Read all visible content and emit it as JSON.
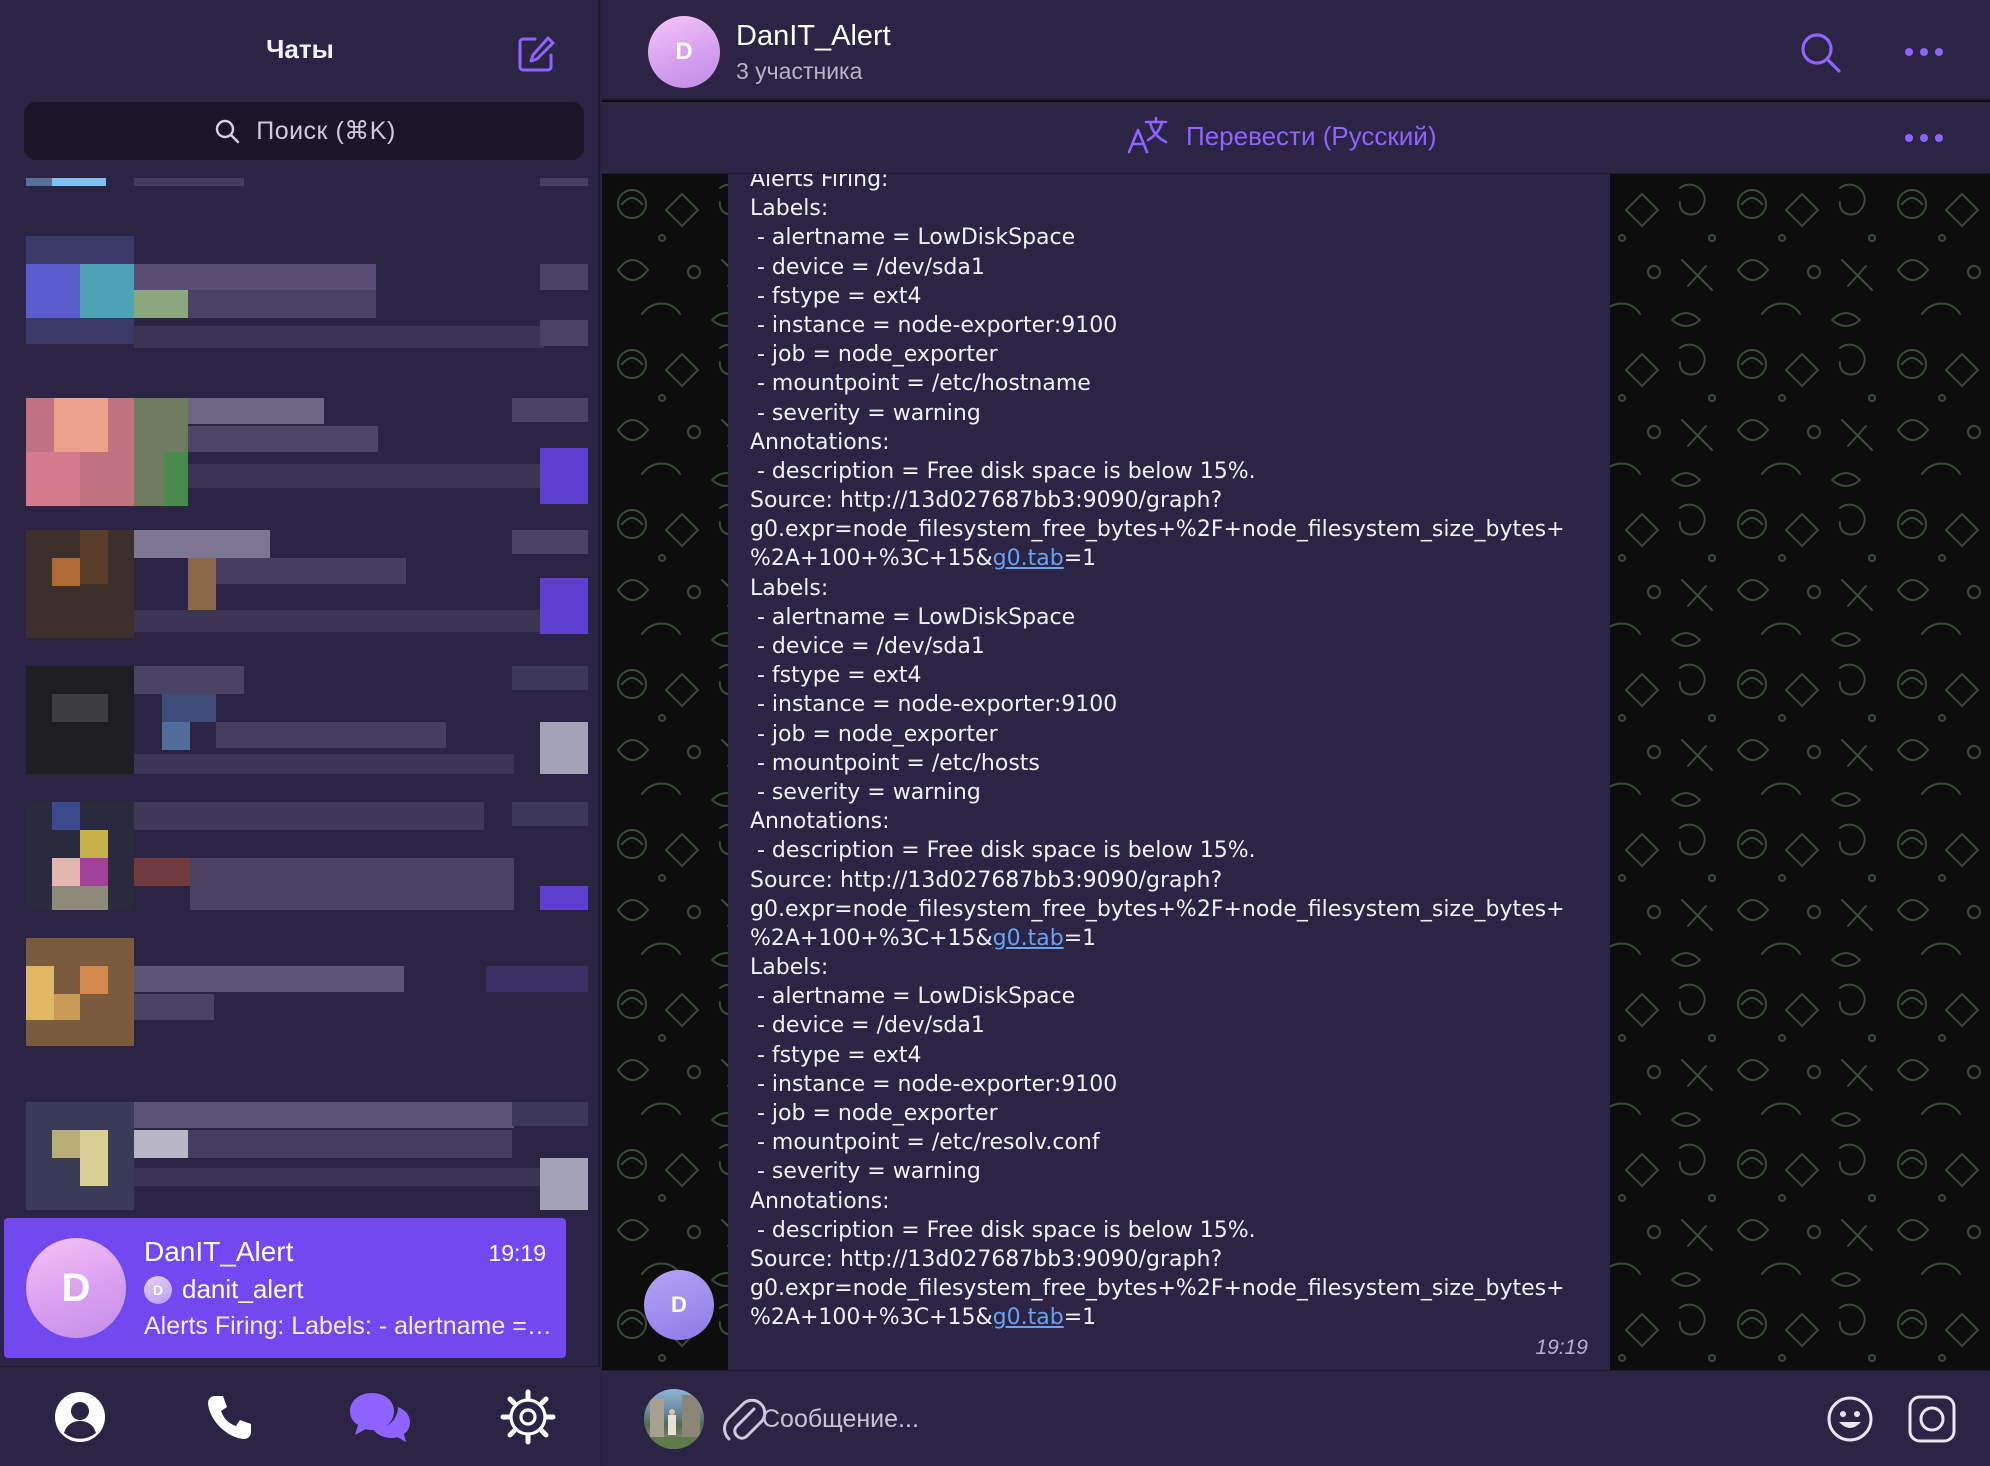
{
  "sidebar": {
    "title": "Чаты",
    "search_placeholder": "Поиск (⌘K)",
    "active_chat": {
      "avatar_letter": "D",
      "name": "DanIT_Alert",
      "time": "19:19",
      "sender_avatar_letter": "D",
      "sender": "danit_alert",
      "preview": "Alerts Firing: Labels:  - alertname = LowDiskSpace"
    },
    "tabs": [
      {
        "name": "contacts",
        "icon": "person-icon"
      },
      {
        "name": "calls",
        "icon": "phone-icon"
      },
      {
        "name": "chats",
        "icon": "chat-bubbles-icon"
      },
      {
        "name": "settings",
        "icon": "gear-icon"
      }
    ]
  },
  "chat": {
    "title": "DanIT_Alert",
    "subtitle": "3 участника",
    "translate_label": "Перевести (Русский)",
    "sender_avatar_letter": "D",
    "message_time": "19:19",
    "message_lines": [
      {
        "text": "Alerts Firing:"
      },
      {
        "text": "Labels:"
      },
      {
        "text": " - alertname = LowDiskSpace"
      },
      {
        "text": " - device = /dev/sda1"
      },
      {
        "text": " - fstype = ext4"
      },
      {
        "text": " - instance = node-exporter:9100"
      },
      {
        "text": " - job = node_exporter"
      },
      {
        "text": " - mountpoint = /etc/hostname"
      },
      {
        "text": " - severity = warning"
      },
      {
        "text": "Annotations:"
      },
      {
        "text": " - description = Free disk space is below 15%."
      },
      {
        "text": "Source: http://13d027687bb3:9090/graph?"
      },
      {
        "text": "g0.expr=node_filesystem_free_bytes+%2F+node_filesystem_size_bytes+"
      },
      {
        "text": "%2A+100+%3C+15&",
        "link": "g0.tab",
        "after": "=1"
      },
      {
        "text": "Labels:"
      },
      {
        "text": " - alertname = LowDiskSpace"
      },
      {
        "text": " - device = /dev/sda1"
      },
      {
        "text": " - fstype = ext4"
      },
      {
        "text": " - instance = node-exporter:9100"
      },
      {
        "text": " - job = node_exporter"
      },
      {
        "text": " - mountpoint = /etc/hosts"
      },
      {
        "text": " - severity = warning"
      },
      {
        "text": "Annotations:"
      },
      {
        "text": " - description = Free disk space is below 15%."
      },
      {
        "text": "Source: http://13d027687bb3:9090/graph?"
      },
      {
        "text": "g0.expr=node_filesystem_free_bytes+%2F+node_filesystem_size_bytes+"
      },
      {
        "text": "%2A+100+%3C+15&",
        "link": "g0.tab",
        "after": "=1"
      },
      {
        "text": "Labels:"
      },
      {
        "text": " - alertname = LowDiskSpace"
      },
      {
        "text": " - device = /dev/sda1"
      },
      {
        "text": " - fstype = ext4"
      },
      {
        "text": " - instance = node-exporter:9100"
      },
      {
        "text": " - job = node_exporter"
      },
      {
        "text": " - mountpoint = /etc/resolv.conf"
      },
      {
        "text": " - severity = warning"
      },
      {
        "text": "Annotations:"
      },
      {
        "text": " - description = Free disk space is below 15%."
      },
      {
        "text": "Source: http://13d027687bb3:9090/graph?"
      },
      {
        "text": "g0.expr=node_filesystem_free_bytes+%2F+node_filesystem_size_bytes+"
      },
      {
        "text": "%2A+100+%3C+15&",
        "link": "g0.tab",
        "after": "=1"
      }
    ],
    "composer_placeholder": "Сообщение..."
  },
  "colors": {
    "accent": "#7248f0",
    "link": "#6aa2f2",
    "icon_purple": "#8f63ff",
    "panel": "#2b2444"
  }
}
